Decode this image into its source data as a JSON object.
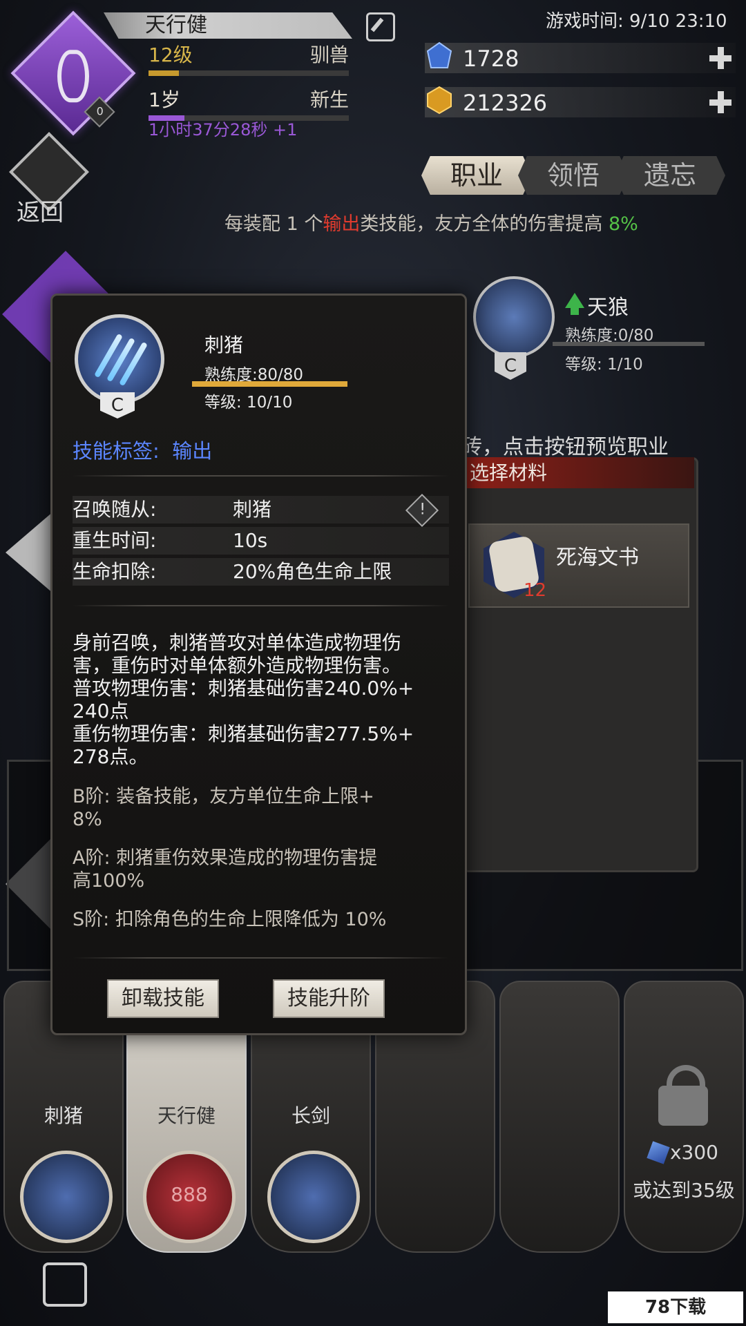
{
  "header": {
    "player_name": "天行健",
    "level": "12级",
    "class": "驯兽",
    "age": "1岁",
    "age_state": "新生",
    "timer": "1小时37分28秒 +1",
    "avatar_badge": "0",
    "game_time": "游戏时间: 9/10 23:10",
    "level_progress": 0.15,
    "age_progress": 0.18
  },
  "currency": {
    "gems": "1728",
    "gold": "212326"
  },
  "nav": {
    "back": "返回",
    "tabs": [
      "职业",
      "领悟",
      "遗忘"
    ]
  },
  "bonus": {
    "prefix": "每装配 1 个",
    "type": "输出",
    "middle": "类技能，友方全体的伤害提高",
    "value": "8%"
  },
  "background_skill": {
    "name": "天狼",
    "proficiency": "熟练度:0/80",
    "level": "等级: 1/10",
    "grade": "C"
  },
  "preview_hint": "砖，点击按钮预览职业",
  "materials": {
    "header": "选择材料",
    "item_name": "死海文书",
    "item_count": "12"
  },
  "modal": {
    "skill_name": "刺猪",
    "grade": "C",
    "proficiency": "熟练度:80/80",
    "proficiency_value": 1.0,
    "level": "等级: 10/10",
    "tag_label": "技能标签:",
    "tag_value": "输出",
    "attributes": [
      {
        "label": "召唤随从:",
        "value": "刺猪"
      },
      {
        "label": "重生时间:",
        "value": "10s"
      },
      {
        "label": "生命扣除:",
        "value": "20%角色生命上限"
      }
    ],
    "description": [
      "身前召唤，刺猪普攻对单体造成物理伤",
      "害，重伤时对单体额外造成物理伤害。",
      "普攻物理伤害：刺猪基础伤害240.0%+",
      "240点",
      "重伤物理伤害：刺猪基础伤害277.5%+",
      "278点。"
    ],
    "tiers": [
      {
        "line1": "B阶: 装备技能，友方单位生命上限+",
        "line2": "8%"
      },
      {
        "line1": "A阶: 刺猪重伤效果造成的物理伤害提",
        "line2": "高100%"
      },
      {
        "line1": "S阶: 扣除角色的生命上限降低为 10%",
        "line2": ""
      }
    ],
    "unload_button": "卸载技能",
    "upgrade_button": "技能升阶"
  },
  "bottom_slots": [
    {
      "label": "刺猪",
      "type": "skill"
    },
    {
      "label": "天行健",
      "type": "pet",
      "circle_text": "888"
    },
    {
      "label": "长剑",
      "type": "weapon"
    },
    {
      "label": "",
      "type": "empty"
    },
    {
      "label": "",
      "type": "empty"
    },
    {
      "label": "",
      "type": "locked",
      "cost": "x300",
      "requirement": "或达到35级"
    }
  ],
  "watermark": "78下载",
  "watermark_url": "4007787878.COM",
  "colors": {
    "accent_purple": "#9b5fd8",
    "tag_blue": "#5b86ff",
    "damage_red": "#e03b2e",
    "bonus_green": "#55c247",
    "bar_gold": "#e0a93a"
  }
}
